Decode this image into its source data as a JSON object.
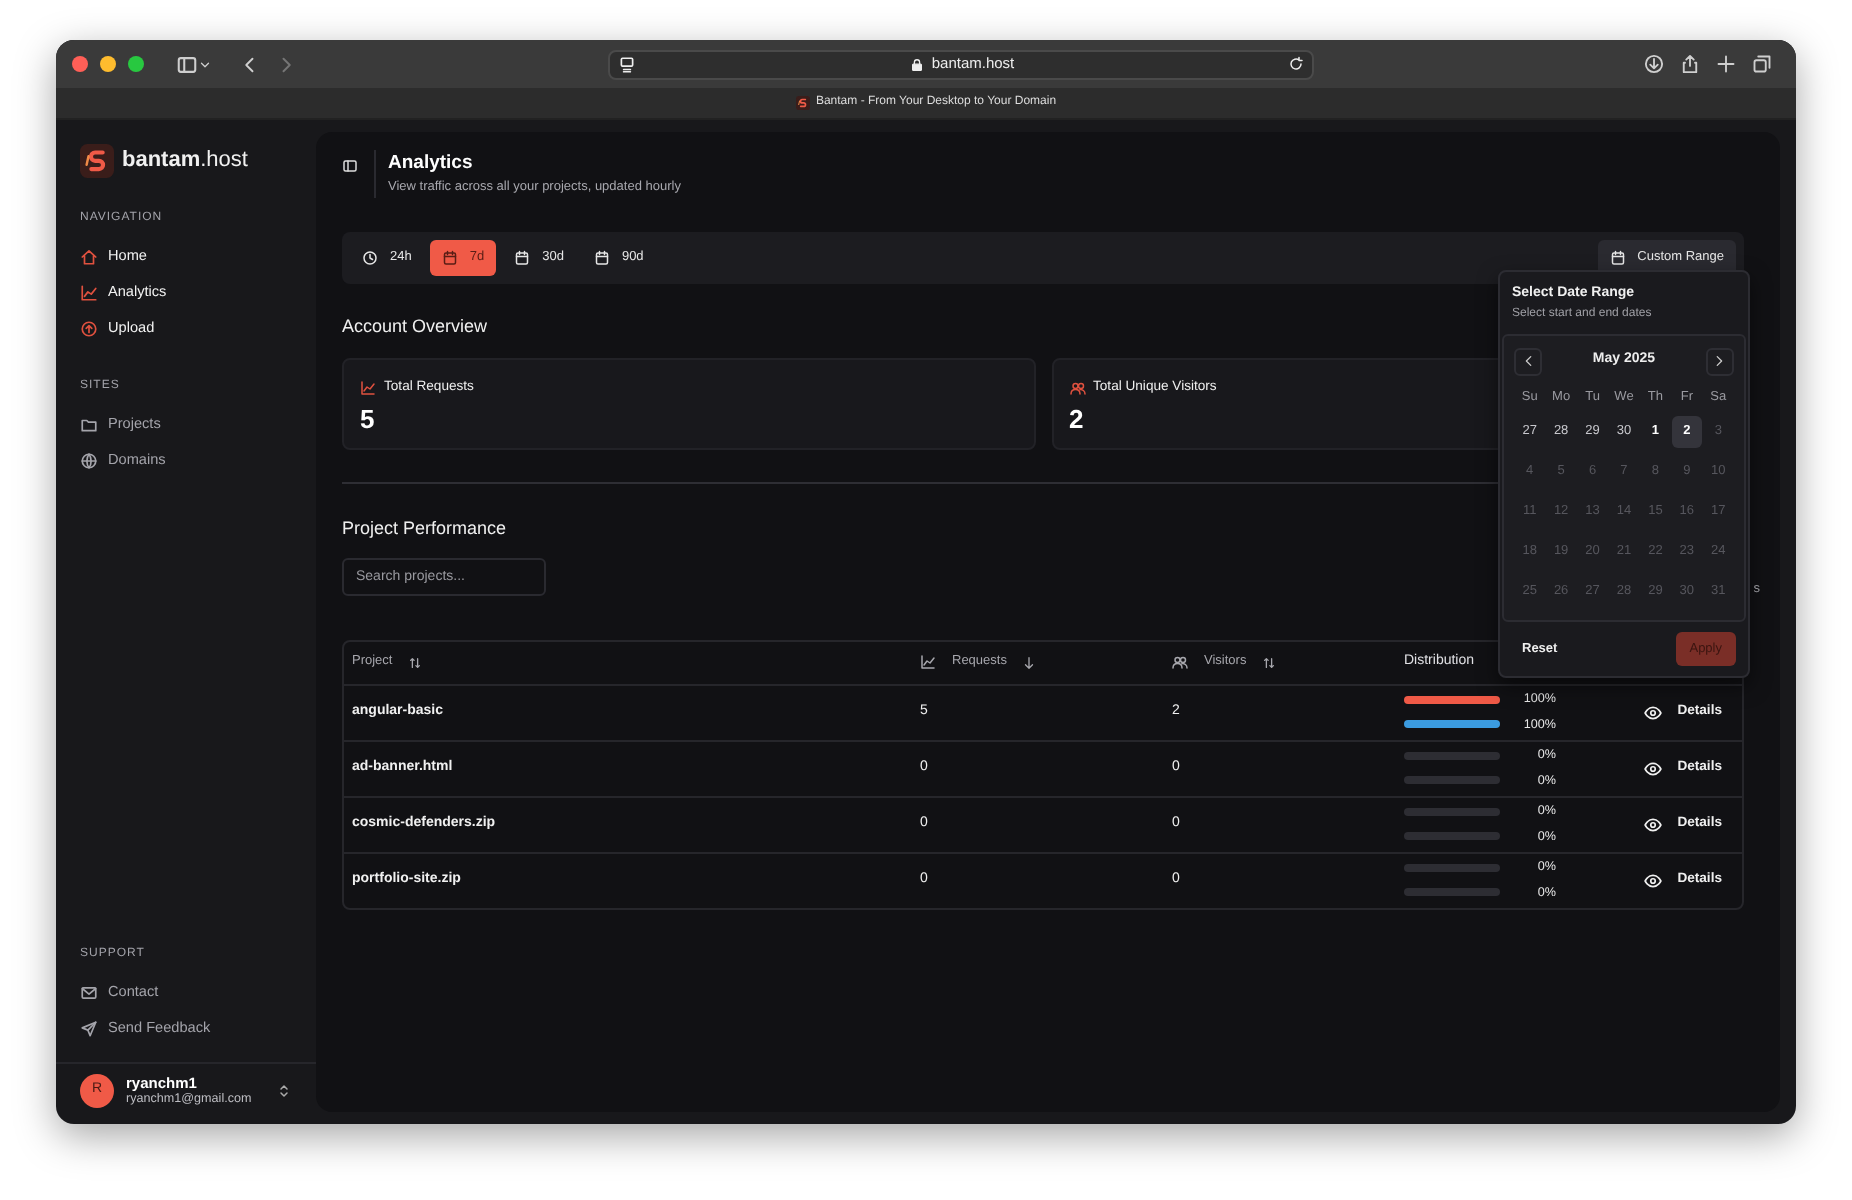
{
  "browser": {
    "url": "bantam.host",
    "tab_title": "Bantam - From Your Desktop to Your Domain"
  },
  "sidebar": {
    "brand": "**bantam**.host",
    "groups": [
      {
        "title": "NAVIGATION",
        "muted": false,
        "items": [
          {
            "label": "Home"
          },
          {
            "label": "Analytics"
          },
          {
            "label": "Upload"
          }
        ]
      },
      {
        "title": "SITES",
        "muted": true,
        "items": [
          {
            "label": "Projects"
          },
          {
            "label": "Domains"
          }
        ]
      },
      {
        "title": "SUPPORT",
        "muted": true,
        "items": [
          {
            "label": "Contact"
          },
          {
            "label": "Send Feedback"
          }
        ]
      }
    ],
    "user": {
      "initial": "R",
      "name": "ryanchm1",
      "email": "ryanchm1@gmail.com"
    }
  },
  "header": {
    "title": "Analytics",
    "subtitle": "View traffic across all your projects, updated hourly"
  },
  "ranges": [
    {
      "label": "24h",
      "selected": false
    },
    {
      "label": "7d",
      "selected": true
    },
    {
      "label": "30d",
      "selected": false
    },
    {
      "label": "90d",
      "selected": false
    }
  ],
  "custom_range": "Custom Range",
  "overview": {
    "title": "Account Overview",
    "stats": [
      {
        "label": "Total Requests",
        "value": "5"
      },
      {
        "label": "Total Unique Visitors",
        "value": "2"
      }
    ]
  },
  "performance": {
    "title": "Project Performance",
    "search_placeholder": "Search projects...",
    "trailing_fragment": "s",
    "columns": [
      "Project",
      "Requests",
      "Visitors",
      "Distribution"
    ],
    "rows": [
      {
        "project": "angular-basic",
        "requests": "5",
        "visitors": "2",
        "requests_bar": {
          "level": 1
        },
        "requests_pct": "100%",
        "visitors_bar": {
          "level": 1
        },
        "visitors_pct": "100%",
        "action": "Details"
      },
      {
        "project": "ad-banner.html",
        "requests": "0",
        "visitors": "0",
        "requests_bar": {
          "level": 0
        },
        "requests_pct": "0%",
        "visitors_bar": {
          "level": 0
        },
        "visitors_pct": "0%",
        "action": "Details"
      },
      {
        "project": "cosmic-defenders.zip",
        "requests": "0",
        "visitors": "0",
        "requests_bar": {
          "level": 0
        },
        "requests_pct": "0%",
        "visitors_bar": {
          "level": 0
        },
        "visitors_pct": "0%",
        "action": "Details"
      },
      {
        "project": "portfolio-site.zip",
        "requests": "0",
        "visitors": "0",
        "requests_bar": {
          "level": 0
        },
        "requests_pct": "0%",
        "visitors_bar": {
          "level": 0
        },
        "visitors_pct": "0%",
        "action": "Details"
      }
    ]
  },
  "date_picker": {
    "title": "Select Date Range",
    "subtitle": "Select start and end dates",
    "month": "May 2025",
    "weekdays": [
      "Su",
      "Mo",
      "Tu",
      "We",
      "Th",
      "Fr",
      "Sa"
    ],
    "weeks": [
      [
        {
          "label": "27",
          "disabled": false,
          "today": false,
          "selected": false
        },
        {
          "label": "28",
          "disabled": false,
          "today": false,
          "selected": false
        },
        {
          "label": "29",
          "disabled": false,
          "today": false,
          "selected": false
        },
        {
          "label": "30",
          "disabled": false,
          "today": false,
          "selected": false
        },
        {
          "label": "1",
          "disabled": false,
          "today": true,
          "selected": false
        },
        {
          "label": "2",
          "disabled": false,
          "today": false,
          "selected": true
        },
        {
          "label": "3",
          "disabled": true,
          "today": false,
          "selected": false
        }
      ],
      [
        {
          "label": "4",
          "disabled": true,
          "today": false,
          "selected": false
        },
        {
          "label": "5",
          "disabled": true,
          "today": false,
          "selected": false
        },
        {
          "label": "6",
          "disabled": true,
          "today": false,
          "selected": false
        },
        {
          "label": "7",
          "disabled": true,
          "today": false,
          "selected": false
        },
        {
          "label": "8",
          "disabled": true,
          "today": false,
          "selected": false
        },
        {
          "label": "9",
          "disabled": true,
          "today": false,
          "selected": false
        },
        {
          "label": "10",
          "disabled": true,
          "today": false,
          "selected": false
        }
      ],
      [
        {
          "label": "11",
          "disabled": true,
          "today": false,
          "selected": false
        },
        {
          "label": "12",
          "disabled": true,
          "today": false,
          "selected": false
        },
        {
          "label": "13",
          "disabled": true,
          "today": false,
          "selected": false
        },
        {
          "label": "14",
          "disabled": true,
          "today": false,
          "selected": false
        },
        {
          "label": "15",
          "disabled": true,
          "today": false,
          "selected": false
        },
        {
          "label": "16",
          "disabled": true,
          "today": false,
          "selected": false
        },
        {
          "label": "17",
          "disabled": true,
          "today": false,
          "selected": false
        }
      ],
      [
        {
          "label": "18",
          "disabled": true,
          "today": false,
          "selected": false
        },
        {
          "label": "19",
          "disabled": true,
          "today": false,
          "selected": false
        },
        {
          "label": "20",
          "disabled": true,
          "today": false,
          "selected": false
        },
        {
          "label": "21",
          "disabled": true,
          "today": false,
          "selected": false
        },
        {
          "label": "22",
          "disabled": true,
          "today": false,
          "selected": false
        },
        {
          "label": "23",
          "disabled": true,
          "today": false,
          "selected": false
        },
        {
          "label": "24",
          "disabled": true,
          "today": false,
          "selected": false
        }
      ],
      [
        {
          "label": "25",
          "disabled": true,
          "today": false,
          "selected": false
        },
        {
          "label": "26",
          "disabled": true,
          "today": false,
          "selected": false
        },
        {
          "label": "27",
          "disabled": true,
          "today": false,
          "selected": false
        },
        {
          "label": "28",
          "disabled": true,
          "today": false,
          "selected": false
        },
        {
          "label": "29",
          "disabled": true,
          "today": false,
          "selected": false
        },
        {
          "label": "30",
          "disabled": true,
          "today": false,
          "selected": false
        },
        {
          "label": "31",
          "disabled": true,
          "today": false,
          "selected": false
        }
      ]
    ],
    "reset": "Reset",
    "apply": "Apply",
    "apply_disabled": true
  }
}
